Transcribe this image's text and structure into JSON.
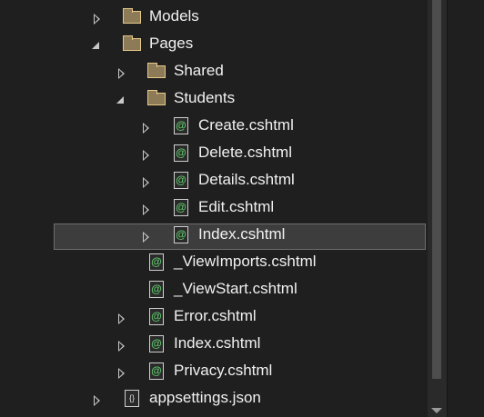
{
  "tree": [
    {
      "label": "Models",
      "level": 0,
      "state": "collapsed",
      "icon": "folder-icon"
    },
    {
      "label": "Pages",
      "level": 0,
      "state": "expanded",
      "icon": "folder-icon"
    },
    {
      "label": "Shared",
      "level": 1,
      "state": "collapsed",
      "icon": "folder-icon"
    },
    {
      "label": "Students",
      "level": 1,
      "state": "expanded",
      "icon": "folder-icon"
    },
    {
      "label": "Create.cshtml",
      "level": 2,
      "state": "collapsed",
      "icon": "razor-file-icon"
    },
    {
      "label": "Delete.cshtml",
      "level": 2,
      "state": "collapsed",
      "icon": "razor-file-icon"
    },
    {
      "label": "Details.cshtml",
      "level": 2,
      "state": "collapsed",
      "icon": "razor-file-icon"
    },
    {
      "label": "Edit.cshtml",
      "level": 2,
      "state": "collapsed",
      "icon": "razor-file-icon"
    },
    {
      "label": "Index.cshtml",
      "level": 2,
      "state": "collapsed",
      "icon": "razor-file-icon",
      "selected": true
    },
    {
      "label": "_ViewImports.cshtml",
      "level": 1,
      "state": "none",
      "icon": "razor-file-icon"
    },
    {
      "label": "_ViewStart.cshtml",
      "level": 1,
      "state": "none",
      "icon": "razor-file-icon"
    },
    {
      "label": "Error.cshtml",
      "level": 1,
      "state": "collapsed",
      "icon": "razor-file-icon"
    },
    {
      "label": "Index.cshtml",
      "level": 1,
      "state": "collapsed",
      "icon": "razor-file-icon"
    },
    {
      "label": "Privacy.cshtml",
      "level": 1,
      "state": "collapsed",
      "icon": "razor-file-icon"
    },
    {
      "label": "appsettings.json",
      "level": 0,
      "state": "collapsed",
      "icon": "json-file-icon"
    }
  ],
  "icon_glyphs": {
    "razor": "@",
    "json": "{}"
  },
  "colors": {
    "background": "#1f1f1f",
    "folder": "#e6c98a",
    "razor_at": "#5fc76a",
    "selection": "#3d3d3d"
  }
}
